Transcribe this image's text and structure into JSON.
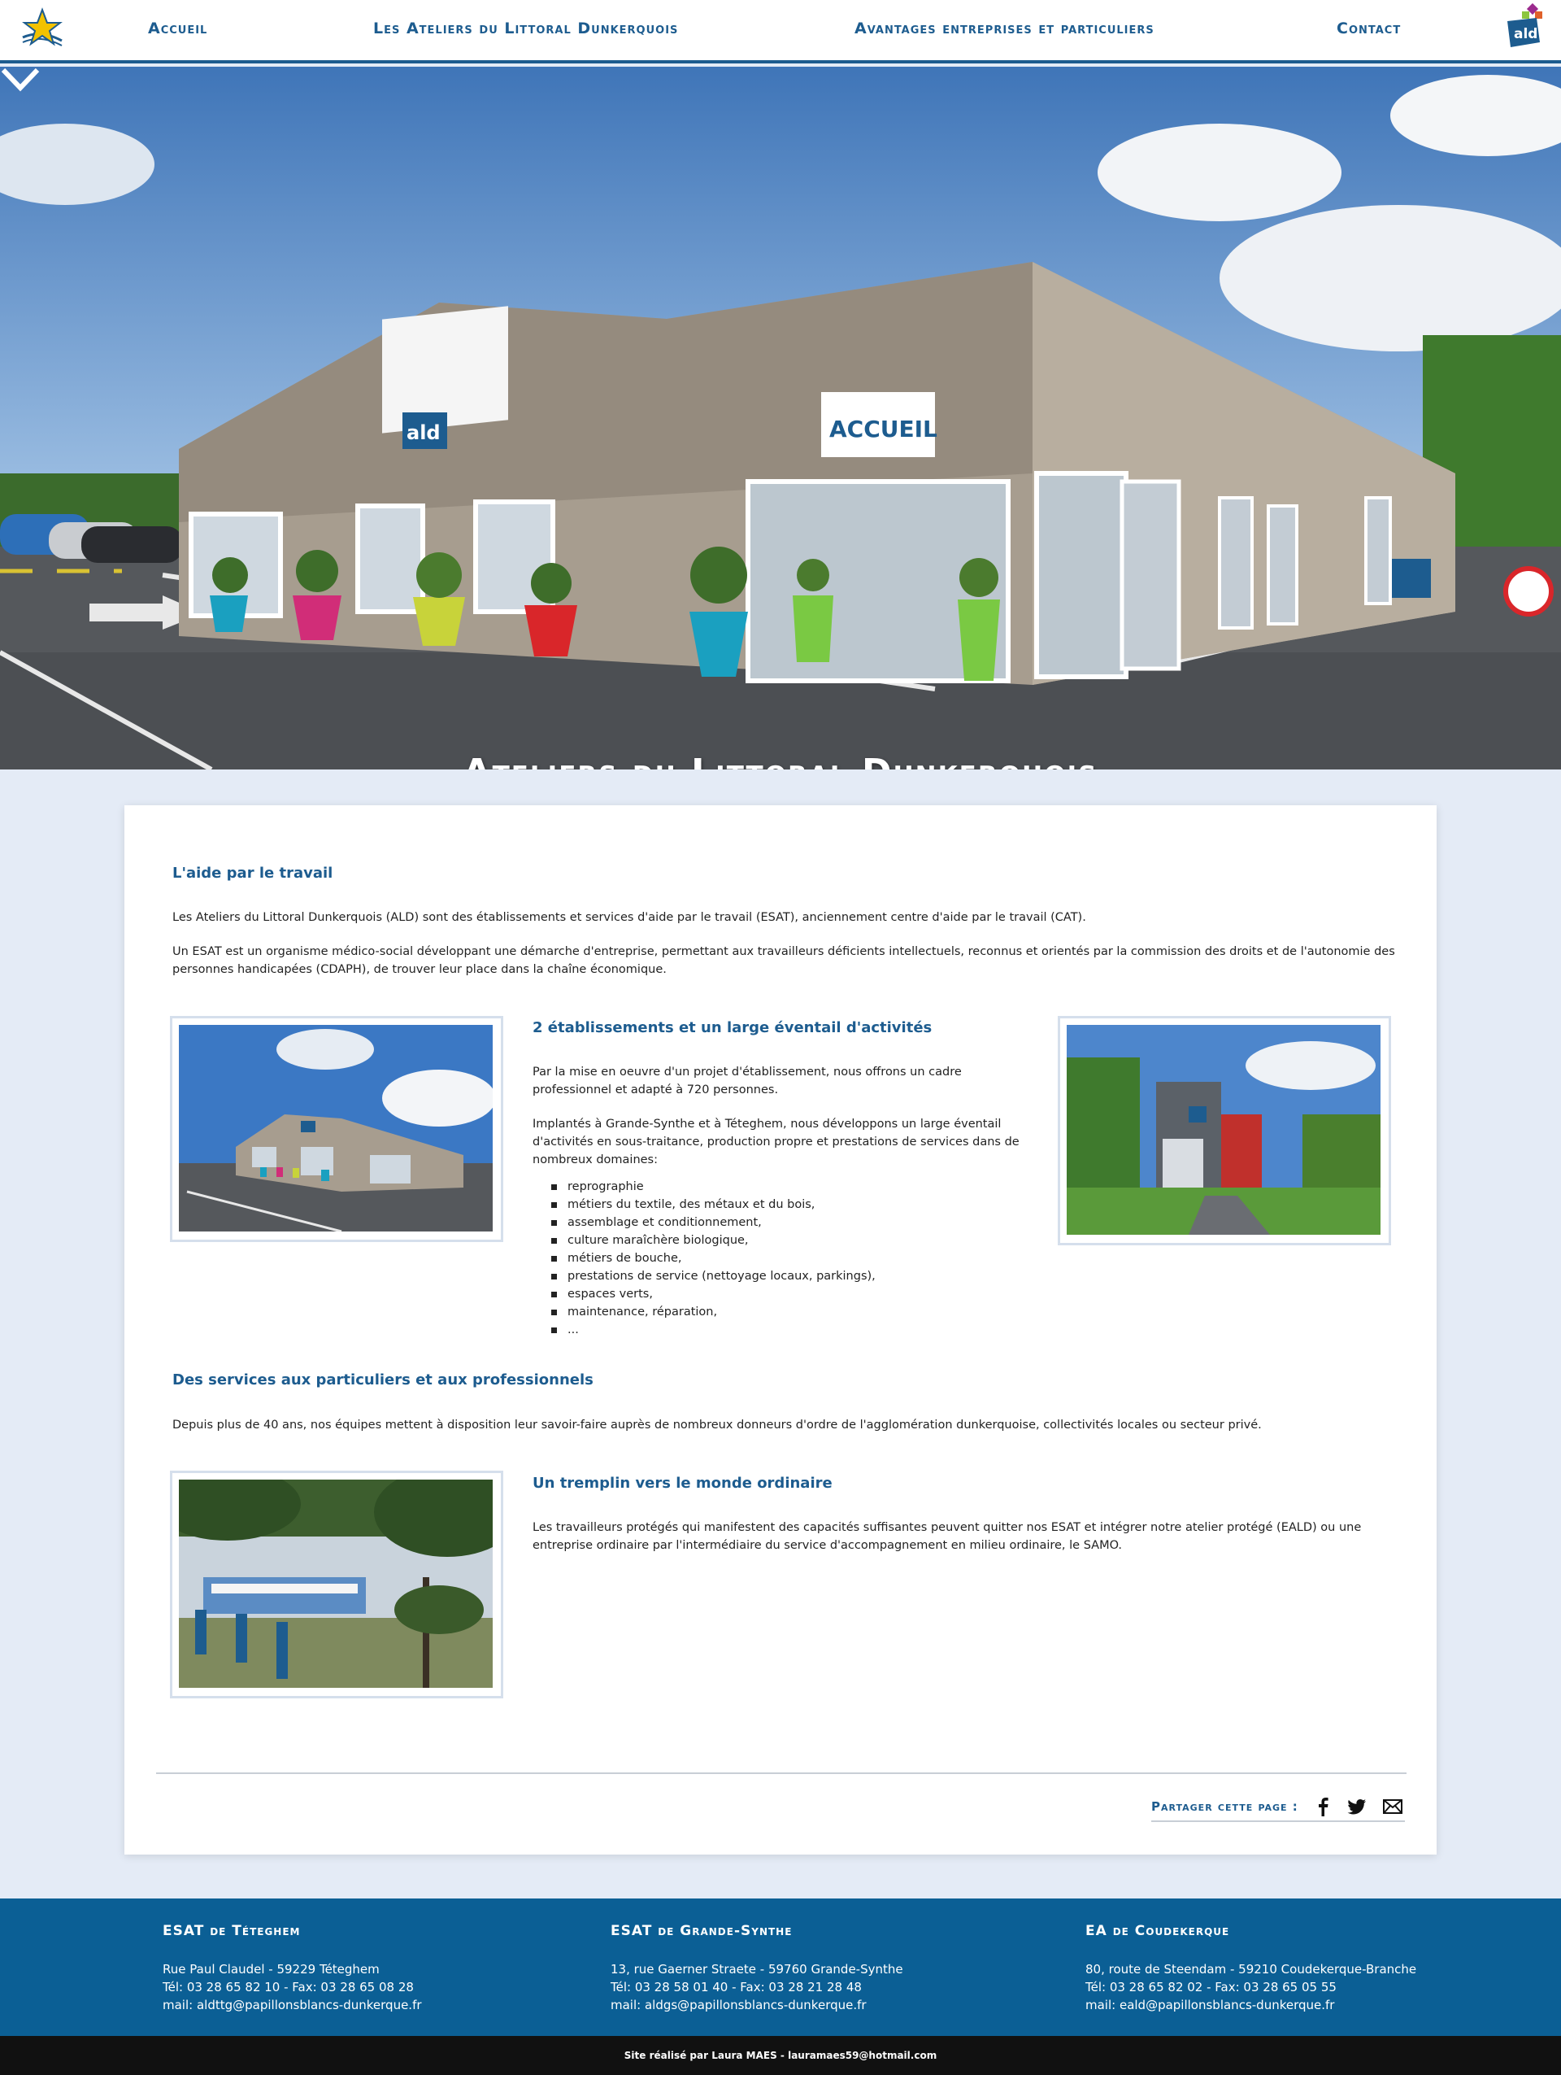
{
  "nav": {
    "items": [
      {
        "label": "Accueil"
      },
      {
        "label": "Les Ateliers du Littoral Dunkerquois"
      },
      {
        "label": "Avantages entreprises et particuliers"
      },
      {
        "label": "Contact"
      }
    ],
    "ald_logo_text": "ald"
  },
  "hero": {
    "title": "Ateliers du Littoral Dunkerquois",
    "sign_left": "ald",
    "sign_right": "ACCUEIL"
  },
  "sections": {
    "aide": {
      "title": "L'aide par le travail",
      "p1": "Les Ateliers du Littoral Dunkerquois (ALD) sont des établissements et services d'aide par le travail (ESAT), anciennement centre d'aide par le travail (CAT).",
      "p2_line1": "Un ESAT est un organisme médico-social développant une démarche d'entreprise, permettant aux travailleurs déficients intellectuels, reconnus et orientés par la commission des droits et de l'autonomie des",
      "p2_line2": "personnes handicapées (CDAPH), de trouver leur place dans la chaîne économique."
    },
    "etablissements": {
      "title": "2 établissements et un large éventail d'activités",
      "p1_line1": "Par la mise en oeuvre d'un projet d'établissement, nous offrons un cadre",
      "p1_line2": "professionnel et adapté à 720 personnes.",
      "p2_line1": "Implantés à Grande-Synthe et à Téteghem, nous développons un large éventail",
      "p2_line2": "d'activités en sous-traitance, production propre et prestations de services dans de",
      "p2_line3": "nombreux domaines:",
      "activities": [
        "reprographie",
        "métiers du textile, des métaux et du bois,",
        "assemblage et conditionnement,",
        "culture maraîchère biologique,",
        "métiers de bouche,",
        "prestations de service (nettoyage locaux, parkings),",
        "espaces verts,",
        "maintenance, réparation,",
        "..."
      ]
    },
    "services": {
      "title": "Des services aux particuliers et aux professionnels",
      "p1": "Depuis plus de 40 ans, nos équipes mettent à disposition leur savoir-faire auprès de nombreux donneurs d'ordre de l'agglomération dunkerquoise, collectivités locales ou secteur privé."
    },
    "tremplin": {
      "title": "Un tremplin vers le monde ordinaire",
      "p1_line1": "Les travailleurs protégés qui manifestent des capacités suffisantes peuvent quitter nos ESAT et intégrer notre atelier protégé (EALD) ou une",
      "p1_line2": "entreprise ordinaire par l'intermédiaire du service d'accompagnement en milieu ordinaire, le SAMO."
    }
  },
  "share": {
    "label": "Partager cette page :",
    "icons": [
      "facebook-icon",
      "twitter-icon",
      "mail-icon"
    ]
  },
  "footer": {
    "columns": [
      {
        "title": "ESAT de Téteghem",
        "address": "Rue Paul Claudel - 59229 Téteghem",
        "phone": "Tél: 03 28 65 82 10 - Fax: 03 28 65 08 28",
        "mail": "mail: aldttg@papillonsblancs-dunkerque.fr"
      },
      {
        "title": "ESAT de Grande-Synthe",
        "address": "13, rue Gaerner Straete - 59760 Grande-Synthe",
        "phone": "Tél: 03 28 58 01 40 - Fax: 03 28 21 28 48",
        "mail": "mail: aldgs@papillonsblancs-dunkerque.fr"
      },
      {
        "title": "EA de Coudekerque",
        "address": "80, route de Steendam - 59210 Coudekerque-Branche",
        "phone": "Tél: 03 28 65 82 02 - Fax: 03 28 65 05 55",
        "mail": "mail: eald@papillonsblancs-dunkerque.fr"
      }
    ],
    "credits": "Site réalisé par Laura MAES - lauramaes59@hotmail.com"
  },
  "colors": {
    "brand": "#1d5c8f",
    "footer": "#0b5f95",
    "page_bg": "#e4ebf6"
  }
}
